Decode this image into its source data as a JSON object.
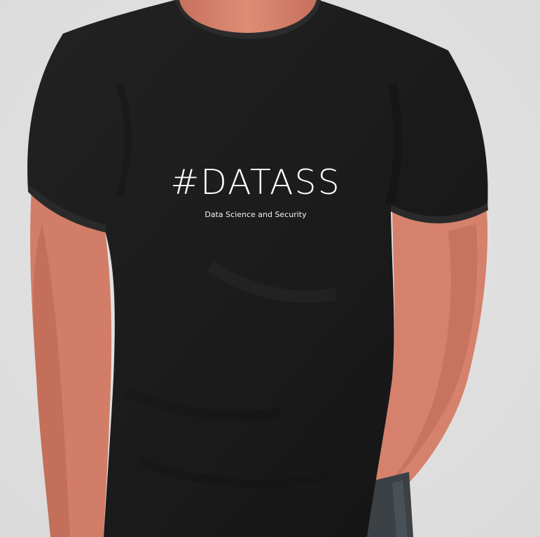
{
  "product": {
    "type": "t-shirt",
    "shirt_color": "#1b1b1b",
    "background_color": "#e3e3e3",
    "skin_color": "#d9846f",
    "jeans_color": "#3b4145",
    "print": {
      "title": "#DATASS",
      "subtitle": "Data Science and Security",
      "ink_color": "#ffffff"
    }
  }
}
